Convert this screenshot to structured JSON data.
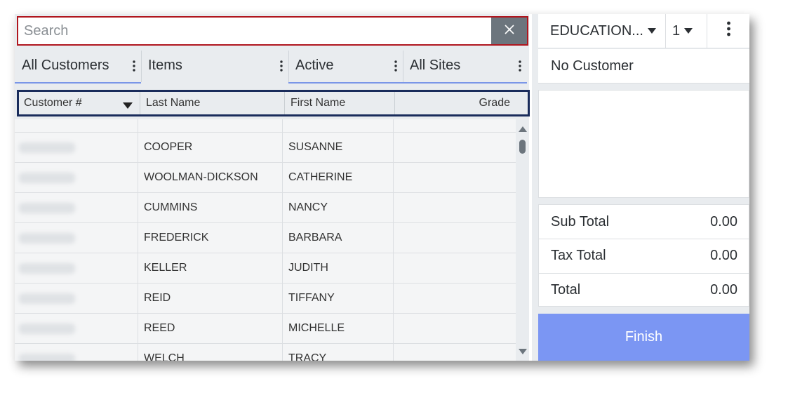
{
  "search": {
    "placeholder": "Search",
    "value": ""
  },
  "filters": [
    {
      "label": "All Customers"
    },
    {
      "label": "Items"
    },
    {
      "label": "Active"
    },
    {
      "label": "All Sites"
    }
  ],
  "columns": [
    {
      "label": "Customer #"
    },
    {
      "label": "Last Name"
    },
    {
      "label": "First Name"
    },
    {
      "label": "Grade"
    }
  ],
  "rows": [
    {
      "customer_no": "",
      "last_name": "",
      "first_name": "",
      "grade": ""
    },
    {
      "customer_no": "",
      "last_name": "COOPER",
      "first_name": "SUSANNE",
      "grade": ""
    },
    {
      "customer_no": "",
      "last_name": "WOOLMAN-DICKSON",
      "first_name": "CATHERINE",
      "grade": ""
    },
    {
      "customer_no": "",
      "last_name": "CUMMINS",
      "first_name": "NANCY",
      "grade": ""
    },
    {
      "customer_no": "",
      "last_name": "FREDERICK",
      "first_name": "BARBARA",
      "grade": ""
    },
    {
      "customer_no": "",
      "last_name": "KELLER",
      "first_name": "JUDITH",
      "grade": ""
    },
    {
      "customer_no": "",
      "last_name": "REID",
      "first_name": "TIFFANY",
      "grade": ""
    },
    {
      "customer_no": "",
      "last_name": "REED",
      "first_name": "MICHELLE",
      "grade": ""
    },
    {
      "customer_no": "",
      "last_name": "WELCH",
      "first_name": "TRACY",
      "grade": ""
    }
  ],
  "right": {
    "site_select": "EDUCATION...",
    "register_select": "1",
    "customer": "No Customer",
    "totals": [
      {
        "label": "Sub Total",
        "value": "0.00"
      },
      {
        "label": "Tax Total",
        "value": "0.00"
      },
      {
        "label": "Total",
        "value": "0.00"
      }
    ],
    "finish_label": "Finish"
  },
  "colors": {
    "search_border": "#b0161e",
    "header_border": "#1a2c5b",
    "finish_button": "#7b96f3",
    "filter_underline": "#7a96e8"
  },
  "icons": {
    "clear": "close-icon",
    "filter_menu": "kebab-menu-icon",
    "sort": "sort-desc-icon",
    "more": "more-vertical-icon"
  }
}
